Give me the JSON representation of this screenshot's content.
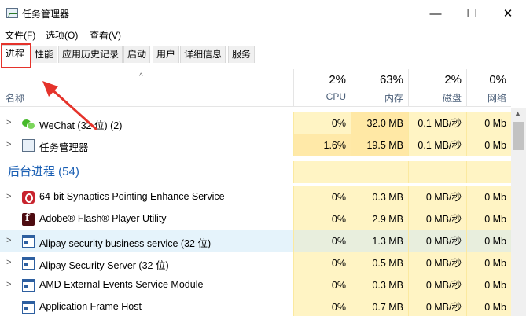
{
  "window": {
    "title": "任务管理器",
    "minimize": "—",
    "maximize": "☐",
    "close": "✕"
  },
  "menu": [
    "文件(F)",
    "选项(O)",
    "查看(V)"
  ],
  "tabs": [
    "进程",
    "性能",
    "应用历史记录",
    "启动",
    "用户",
    "详细信息",
    "服务"
  ],
  "columns": {
    "name_label": "名称",
    "cpu": {
      "pct": "2%",
      "label": "CPU"
    },
    "memory": {
      "pct": "63%",
      "label": "内存"
    },
    "disk": {
      "pct": "2%",
      "label": "磁盘"
    },
    "network": {
      "pct": "0%",
      "label": "网络"
    }
  },
  "apps": [
    {
      "name": "WeChat (32 位) (2)",
      "icon": "wechat-icon",
      "cpu": "0%",
      "memory": "32.0 MB",
      "disk": "0.1 MB/秒",
      "network": "0 Mb"
    },
    {
      "name": "任务管理器",
      "icon": "task-manager-icon",
      "cpu": "1.6%",
      "memory": "19.5 MB",
      "disk": "0.1 MB/秒",
      "network": "0 Mb"
    }
  ],
  "background_group": "后台进程 (54)",
  "background": [
    {
      "name": "64-bit Synaptics Pointing Enhance Service",
      "icon": "synaptics-icon",
      "expandable": true,
      "cpu": "0%",
      "memory": "0.3 MB",
      "disk": "0 MB/秒",
      "network": "0 Mb"
    },
    {
      "name": "Adobe® Flash® Player Utility",
      "icon": "flash-icon",
      "expandable": false,
      "cpu": "0%",
      "memory": "2.9 MB",
      "disk": "0 MB/秒",
      "network": "0 Mb"
    },
    {
      "name": "Alipay security business service (32 位)",
      "icon": "service-icon",
      "expandable": true,
      "cpu": "0%",
      "memory": "1.3 MB",
      "disk": "0 MB/秒",
      "network": "0 Mb"
    },
    {
      "name": "Alipay Security Server (32 位)",
      "icon": "service-icon",
      "expandable": true,
      "cpu": "0%",
      "memory": "0.5 MB",
      "disk": "0 MB/秒",
      "network": "0 Mb"
    },
    {
      "name": "AMD External Events Service Module",
      "icon": "service-icon",
      "expandable": true,
      "cpu": "0%",
      "memory": "0.3 MB",
      "disk": "0 MB/秒",
      "network": "0 Mb"
    },
    {
      "name": "Application Frame Host",
      "icon": "service-icon",
      "expandable": false,
      "cpu": "0%",
      "memory": "0.7 MB",
      "disk": "0 MB/秒",
      "network": "0 Mb"
    }
  ],
  "colors": {
    "accent_red": "#e5332b",
    "heat_yellow": "#fff4c4",
    "group_blue": "#1a5fb4"
  }
}
